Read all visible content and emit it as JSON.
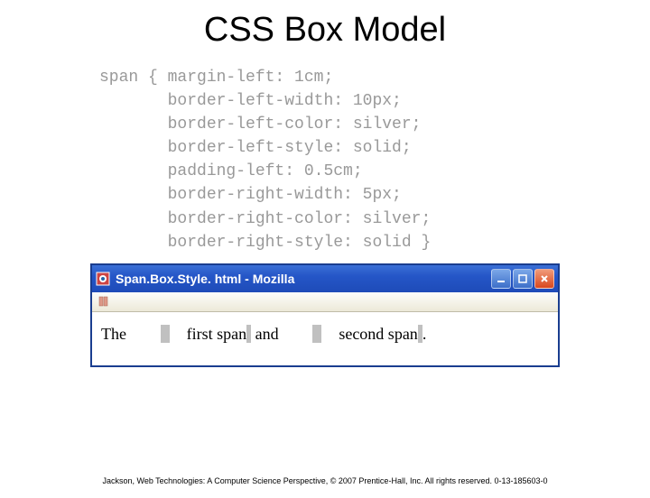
{
  "title": "CSS Box Model",
  "code": "span { margin-left: 1cm;\n       border-left-width: 10px;\n       border-left-color: silver;\n       border-left-style: solid;\n       padding-left: 0.5cm;\n       border-right-width: 5px;\n       border-right-color: silver;\n       border-right-style: solid }",
  "browser": {
    "title": "Span.Box.Style. html - Mozilla",
    "content": {
      "before": "The",
      "span1": "first span",
      "middle": " and",
      "span2": "second span",
      "after": "."
    }
  },
  "footer": "Jackson, Web Technologies: A Computer Science Perspective, © 2007 Prentice-Hall, Inc. All rights reserved. 0-13-185603-0"
}
